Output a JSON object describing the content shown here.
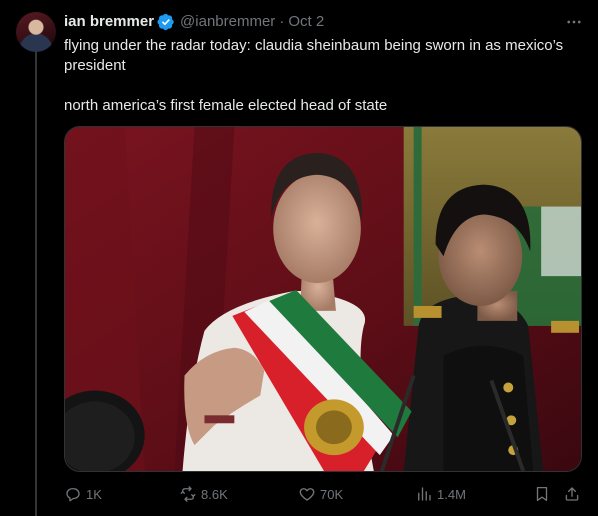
{
  "tweet": {
    "author_name": "ian bremmer",
    "handle": "@ianbremmer",
    "separator": "·",
    "date": "Oct 2",
    "verified": true,
    "more_icon": "more-horizontal-icon",
    "text_line1": "flying under the radar today: claudia sheinbaum being sworn in as mexico’s president",
    "text_line2": "north america’s first female elected head of state",
    "media_icon": "photo"
  },
  "actions": {
    "replies": "1K",
    "retweets": "8.6K",
    "likes": "70K",
    "views": "1.4M"
  },
  "colors": {
    "background": "#000000",
    "text": "#e7e9ea",
    "muted": "#71767b",
    "verified_badge": "#1d9bf0",
    "border": "#2f3336"
  }
}
